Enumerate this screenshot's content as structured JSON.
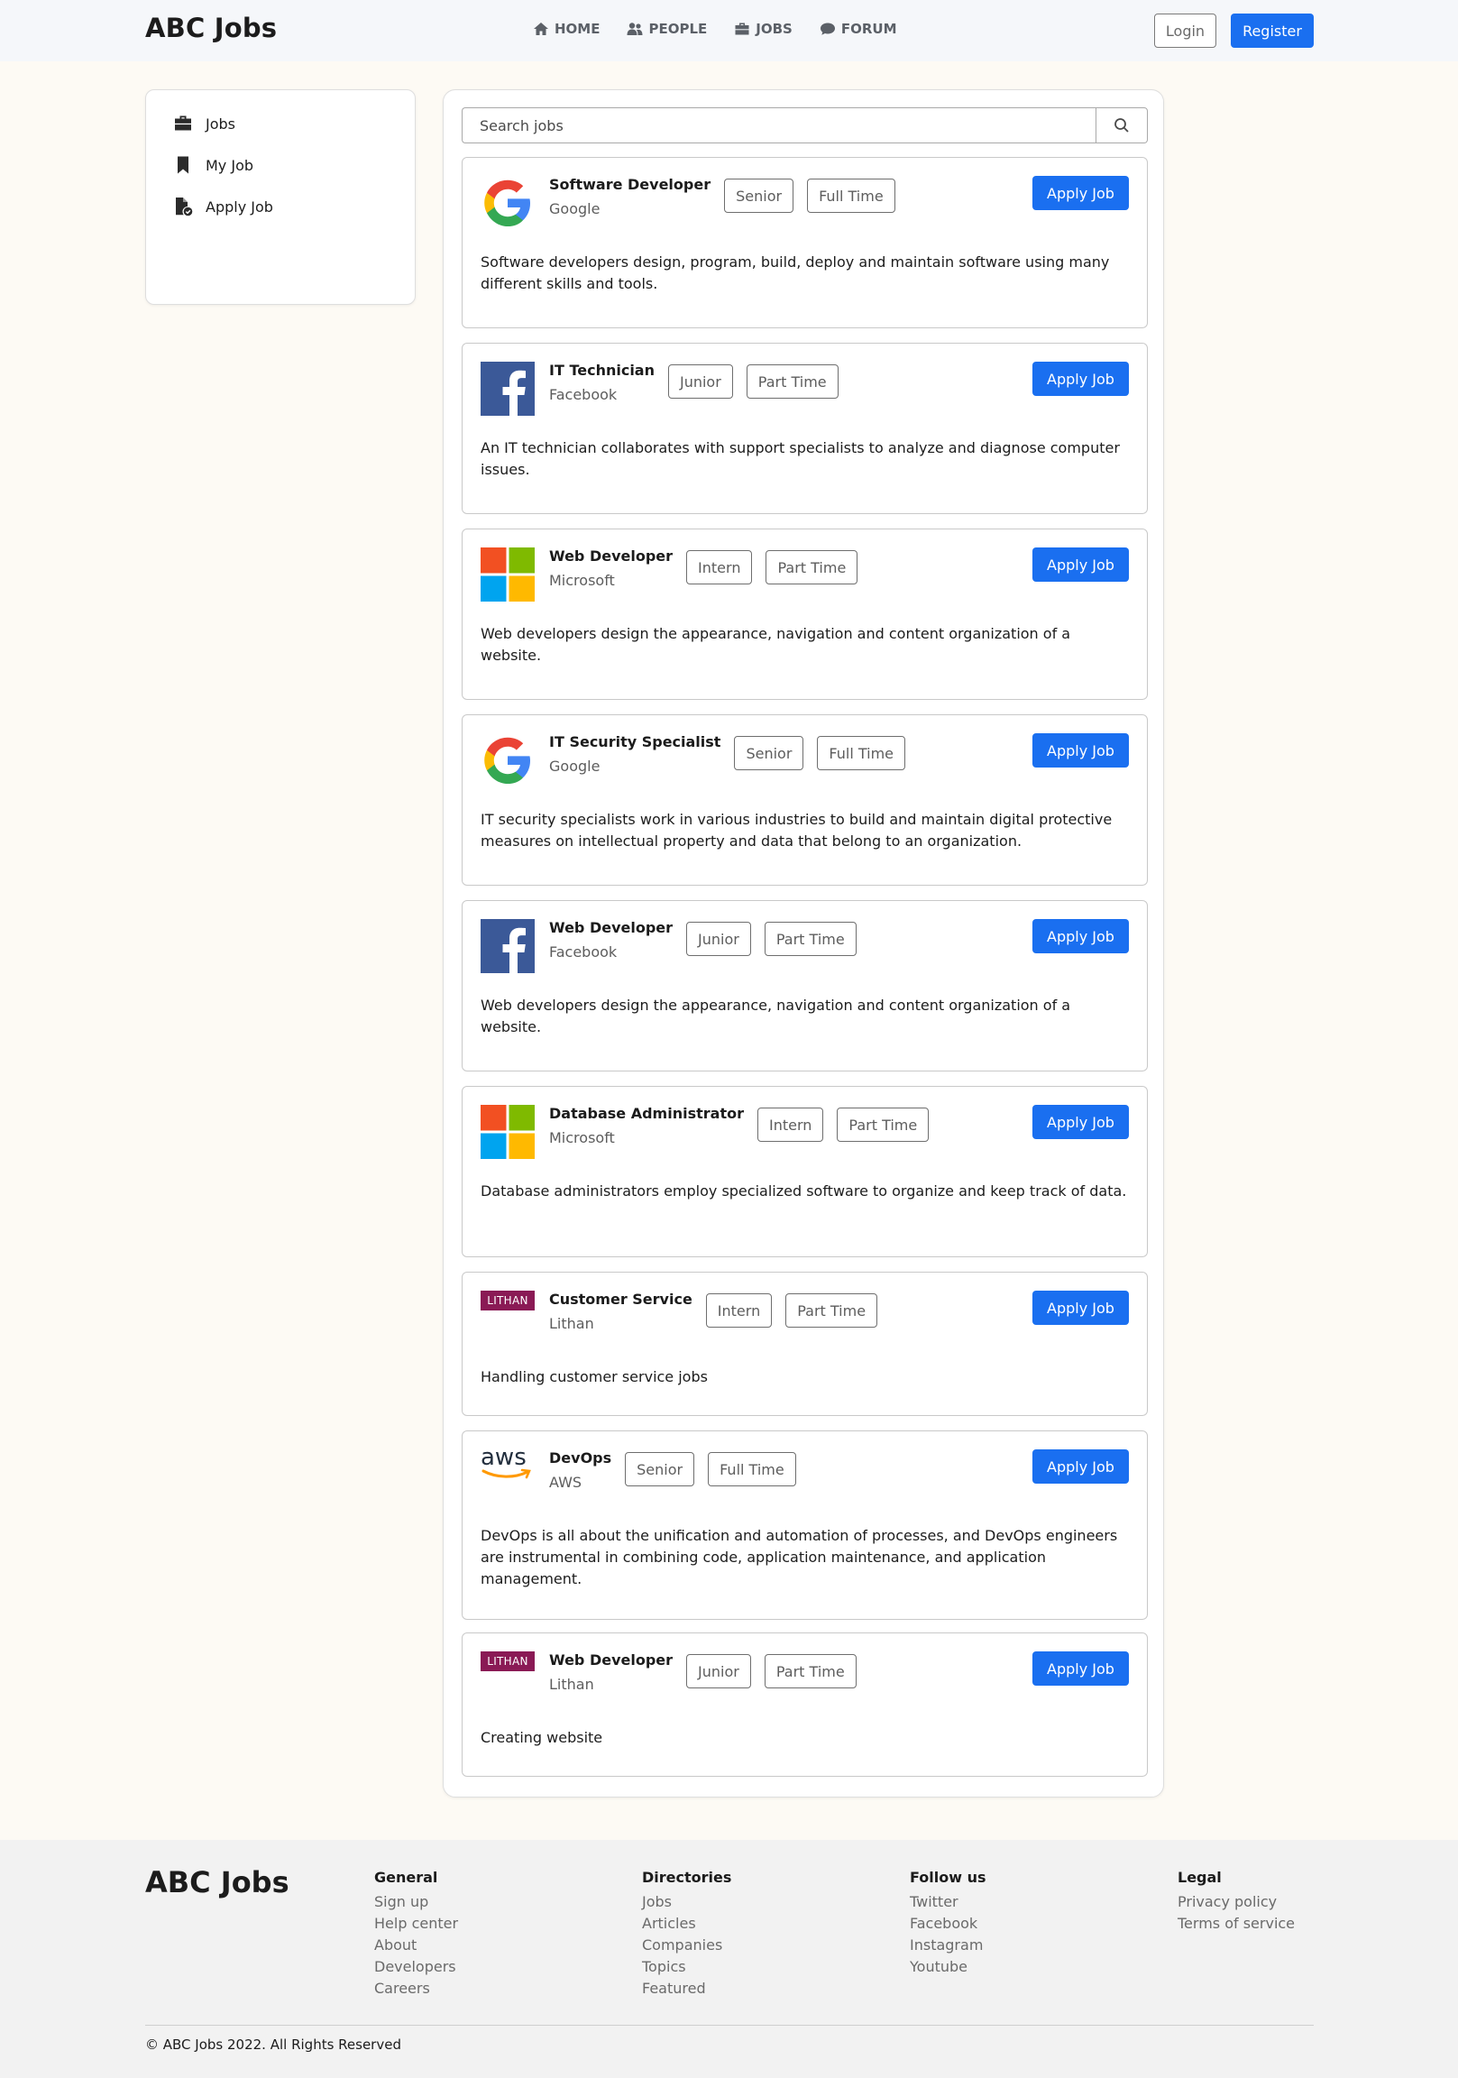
{
  "header": {
    "brand": "ABC Jobs",
    "nav": [
      {
        "label": "HOME",
        "icon": "home-icon"
      },
      {
        "label": "PEOPLE",
        "icon": "people-icon"
      },
      {
        "label": "JOBS",
        "icon": "briefcase-icon"
      },
      {
        "label": "FORUM",
        "icon": "comment-icon"
      }
    ],
    "login_label": "Login",
    "register_label": "Register"
  },
  "sidebar": {
    "items": [
      {
        "label": "Jobs",
        "icon": "briefcase-icon"
      },
      {
        "label": "My Job",
        "icon": "bookmark-icon"
      },
      {
        "label": "Apply Job",
        "icon": "file-check-icon"
      }
    ]
  },
  "search": {
    "placeholder": "Search jobs",
    "icon": "search-icon"
  },
  "jobs": [
    {
      "title": "Software Developer",
      "company": "Google",
      "level": "Senior",
      "type": "Full Time",
      "logo": "google-logo",
      "apply_label": "Apply Job",
      "description": "Software developers design, program, build, deploy and maintain software using many different skills and tools."
    },
    {
      "title": "IT Technician",
      "company": "Facebook",
      "level": "Junior",
      "type": "Part Time",
      "logo": "facebook-logo",
      "apply_label": "Apply Job",
      "description": "An IT technician collaborates with support specialists to analyze and diagnose computer issues."
    },
    {
      "title": "Web Developer",
      "company": "Microsoft",
      "level": "Intern",
      "type": "Part Time",
      "logo": "microsoft-logo",
      "apply_label": "Apply Job",
      "description": "Web developers design the appearance, navigation and content organization of a website."
    },
    {
      "title": "IT Security Specialist",
      "company": "Google",
      "level": "Senior",
      "type": "Full Time",
      "logo": "google-logo",
      "apply_label": "Apply Job",
      "description": "IT security specialists work in various industries to build and maintain digital protective measures on intellectual property and data that belong to an organization."
    },
    {
      "title": "Web Developer",
      "company": "Facebook",
      "level": "Junior",
      "type": "Part Time",
      "logo": "facebook-logo",
      "apply_label": "Apply Job",
      "description": "Web developers design the appearance, navigation and content organization of a website."
    },
    {
      "title": "Database Administrator",
      "company": "Microsoft",
      "level": "Intern",
      "type": "Part Time",
      "logo": "microsoft-logo",
      "apply_label": "Apply Job",
      "description": "Database administrators employ specialized software to organize and keep track of data."
    },
    {
      "title": "Customer Service",
      "company": "Lithan",
      "level": "Intern",
      "type": "Part Time",
      "logo": "lithan-logo",
      "logo_text": "LITHAN",
      "apply_label": "Apply Job",
      "description": "Handling customer service jobs"
    },
    {
      "title": "DevOps",
      "company": "AWS",
      "level": "Senior",
      "type": "Full Time",
      "logo": "aws-logo",
      "logo_text": "aws",
      "apply_label": "Apply Job",
      "description": "DevOps is all about the unification and automation of processes, and DevOps engineers are instrumental in combining code, application maintenance, and application management."
    },
    {
      "title": "Web Developer",
      "company": "Lithan",
      "level": "Junior",
      "type": "Part Time",
      "logo": "lithan-logo",
      "logo_text": "LITHAN",
      "apply_label": "Apply Job",
      "description": "Creating website"
    }
  ],
  "footer": {
    "brand": "ABC Jobs",
    "columns": [
      {
        "heading": "General",
        "links": [
          "Sign up",
          "Help center",
          "About",
          "Developers",
          "Careers"
        ]
      },
      {
        "heading": "Directories",
        "links": [
          "Jobs",
          "Articles",
          "Companies",
          "Topics",
          "Featured"
        ]
      },
      {
        "heading": "Follow us",
        "links": [
          "Twitter",
          "Facebook",
          "Instagram",
          "Youtube"
        ]
      },
      {
        "heading": "Legal",
        "links": [
          "Privacy policy",
          "Terms of service"
        ]
      }
    ],
    "copyright": "© ABC Jobs 2022. All Rights Reserved"
  },
  "colors": {
    "accent": "#1a6ff0",
    "page_bg": "#fdfaf4",
    "header_bg": "#f5f7fa",
    "footer_bg": "#f2f2f2",
    "lithan": "#8a1a55"
  }
}
